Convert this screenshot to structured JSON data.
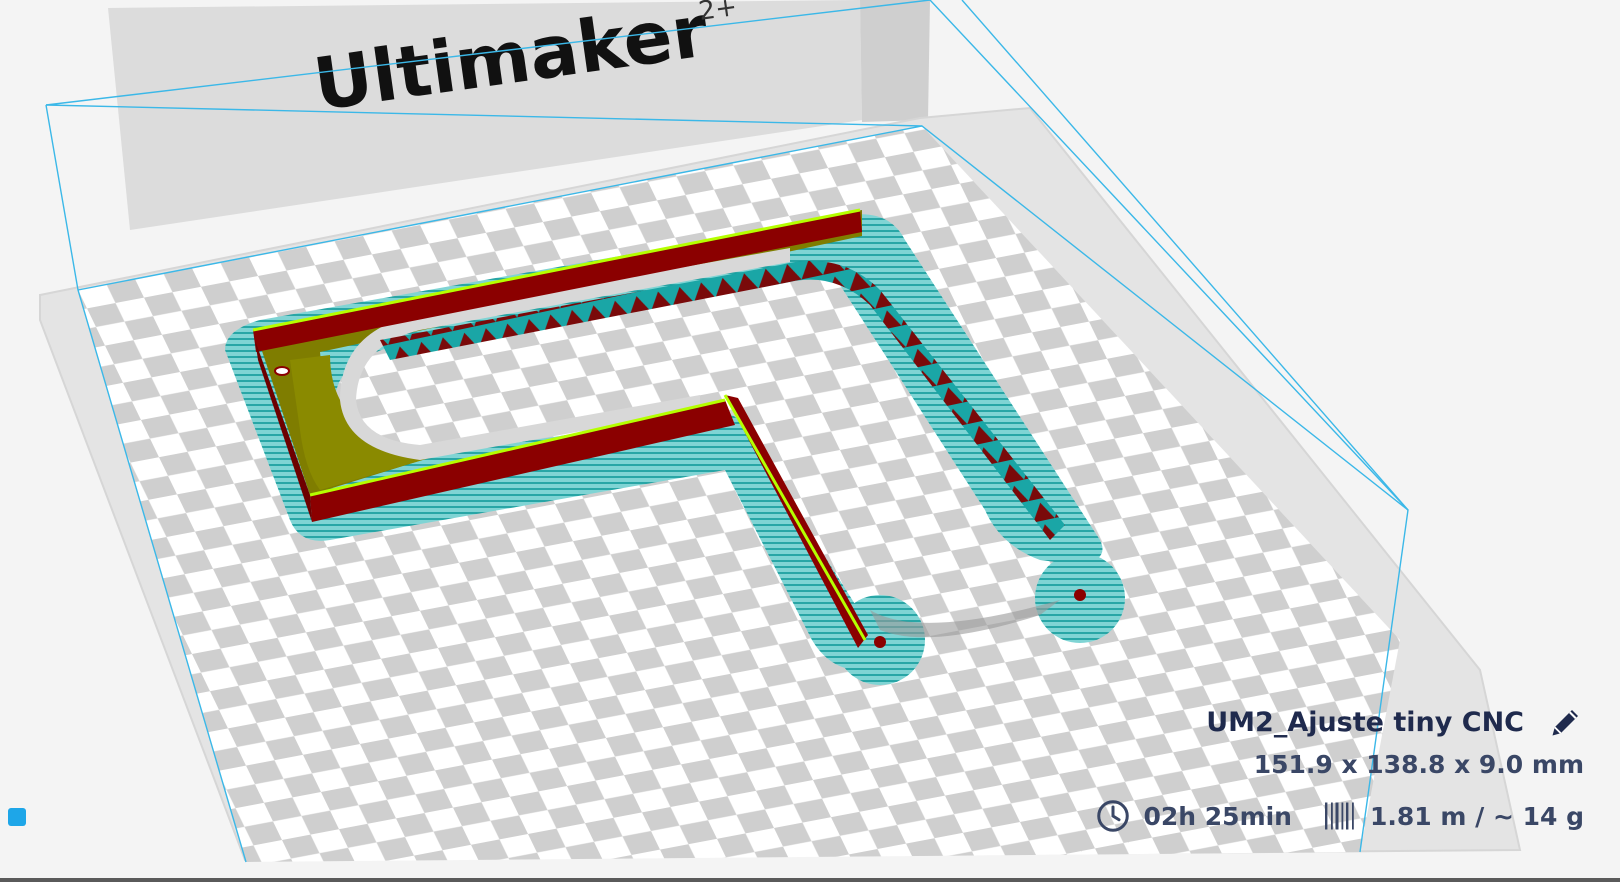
{
  "viewport": {
    "brand_text": "Ultimaker",
    "brand_suffix": "2+"
  },
  "job": {
    "name": "UM2_Ajuste tiny CNC",
    "dimensions": "151.9 x 138.8 x 9.0 mm",
    "print_time": "02h 25min",
    "material": "1.81 m / ~ 14 g"
  },
  "icons": {
    "edit": "pencil-icon",
    "time": "clock-icon",
    "material": "filament-spool-icon",
    "view": "view-cube-icon"
  },
  "colors": {
    "accent": "#1ea6e8",
    "model_wall": "#8b0000",
    "model_top": "#8a8a00",
    "model_highlight": "#b5ff00",
    "skirt": "#1aa6a6",
    "text_dark": "#1f2a4d"
  }
}
